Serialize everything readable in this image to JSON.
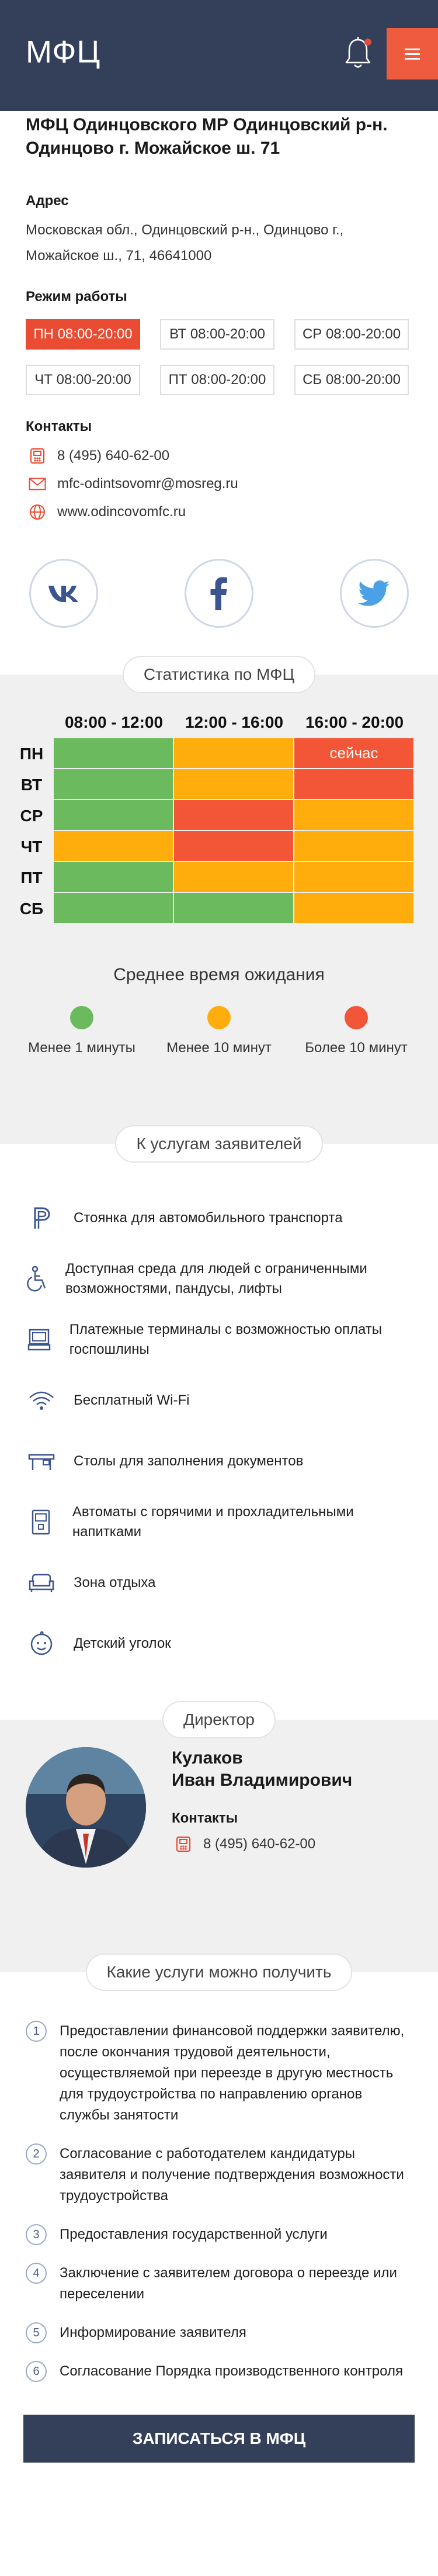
{
  "header": {
    "logo": "МФЦ"
  },
  "office": {
    "title": "МФЦ Одинцовского МР Одинцовский р-н. Одинцово г. Можайское ш. 71",
    "address_heading": "Адрес",
    "address": "Московская обл., Одинцовский р-н., Одинцово г., Можайское ш., 71, 46641000",
    "hours_heading": "Режим работы",
    "hours": [
      {
        "day": "ПН",
        "time": "08:00-20:00",
        "active": true
      },
      {
        "day": "ВТ",
        "time": "08:00-20:00",
        "active": false
      },
      {
        "day": "СР",
        "time": "08:00-20:00",
        "active": false
      },
      {
        "day": "ЧТ",
        "time": "08:00-20:00",
        "active": false
      },
      {
        "day": "ПТ",
        "time": "08:00-20:00",
        "active": false
      },
      {
        "day": "СБ",
        "time": "08:00-20:00",
        "active": false
      }
    ],
    "contacts_heading": "Контакты",
    "phone": "8 (495) 640-62-00",
    "email": "mfc-odintsovomr@mosreg.ru",
    "website": "www.odincovomfc.ru"
  },
  "socials": [
    "vk-icon",
    "facebook-icon",
    "twitter-icon"
  ],
  "stats": {
    "pill": "Статистика по МФЦ",
    "columns": [
      "08:00 - 12:00",
      "12:00 - 16:00",
      "16:00 - 20:00"
    ],
    "now_label": "сейчас",
    "rows": [
      {
        "day": "ПН",
        "load": [
          "green",
          "yellow",
          "red"
        ],
        "now_col": 2
      },
      {
        "day": "ВТ",
        "load": [
          "green",
          "yellow",
          "red"
        ]
      },
      {
        "day": "СР",
        "load": [
          "green",
          "red",
          "yellow"
        ]
      },
      {
        "day": "ЧТ",
        "load": [
          "yellow",
          "red",
          "yellow"
        ]
      },
      {
        "day": "ПТ",
        "load": [
          "green",
          "yellow",
          "yellow"
        ]
      },
      {
        "day": "СБ",
        "load": [
          "green",
          "green",
          "yellow"
        ]
      }
    ],
    "colors": {
      "green": "#6cba5e",
      "yellow": "#ffad0d",
      "red": "#f35537"
    },
    "wait_title": "Среднее время ожидания",
    "legend": [
      {
        "color": "#6cba5e",
        "label": "Менее 1 минуты"
      },
      {
        "color": "#ffad0d",
        "label": "Менее 10 минут"
      },
      {
        "color": "#f35537",
        "label": "Более 10 минут"
      }
    ]
  },
  "amenities": {
    "pill": "К услугам заявителей",
    "items": [
      {
        "icon": "parking-icon",
        "label": "Стоянка для автомобильного транспорта"
      },
      {
        "icon": "wheelchair-icon",
        "label": "Доступная среда для людей с ограниченными возможностями, пандусы, лифты"
      },
      {
        "icon": "terminal-icon",
        "label": "Платежные терминалы с возможностью оплаты госпошлины"
      },
      {
        "icon": "wifi-icon",
        "label": "Бесплатный Wi-Fi"
      },
      {
        "icon": "desk-icon",
        "label": "Столы для заполнения документов"
      },
      {
        "icon": "vending-icon",
        "label": "Автоматы с горячими и прохладительными напитками"
      },
      {
        "icon": "sofa-icon",
        "label": "Зона отдыха"
      },
      {
        "icon": "child-icon",
        "label": "Детский уголок"
      }
    ]
  },
  "director": {
    "pill": "Директор",
    "name_line1": "Кулаков",
    "name_line2": "Иван Владимирович",
    "contacts_heading": "Контакты",
    "phone": "8 (495) 640-62-00"
  },
  "services": {
    "pill": "Какие услуги можно получить",
    "items": [
      {
        "num": "1",
        "text": "Предоставлении финансовой поддержки заявителю, после окончания трудовой деятельности, осуществляемой при переезде в другую местность для трудоустройства по направлению органов службы занятости"
      },
      {
        "num": "2",
        "text": "Согласование с работодателем кандидатуры заявителя и получение подтверждения возможности трудоустройства"
      },
      {
        "num": "3",
        "text": "Предоставления государственной услуги"
      },
      {
        "num": "4",
        "text": "Заключение с заявителем договора о переезде или переселении"
      },
      {
        "num": "5",
        "text": "Информирование заявителя"
      },
      {
        "num": "6",
        "text": "Согласование Порядка производственного контроля"
      }
    ],
    "cta": "ЗАПИСАТЬСЯ В МФЦ"
  }
}
